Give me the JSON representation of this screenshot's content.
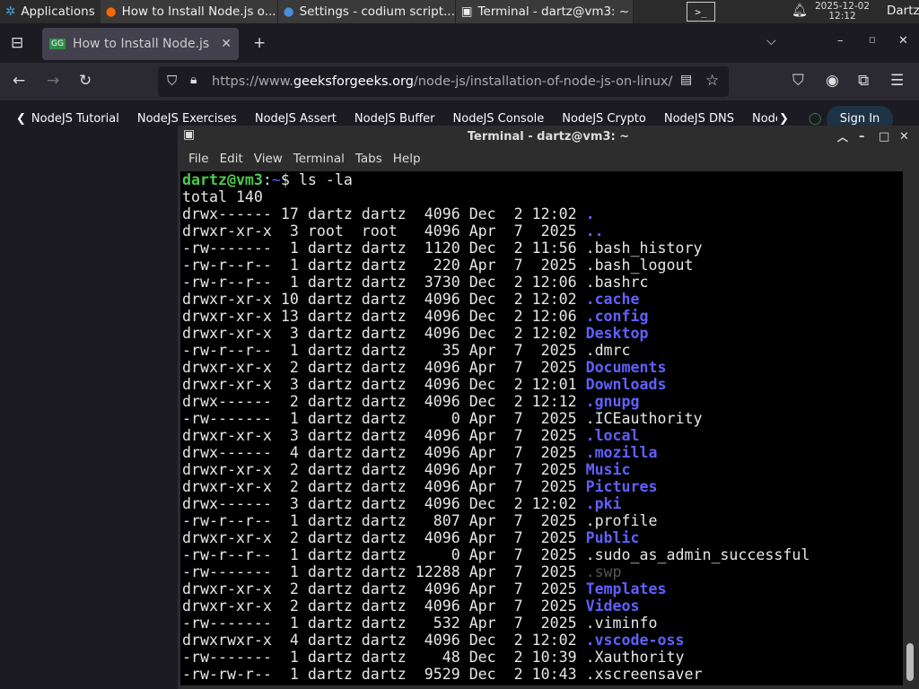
{
  "taskbar": {
    "apps": "Applications",
    "tasks": [
      "How to Install Node.js o...",
      "Settings - codium script...",
      "Terminal - dartz@vm3: ~"
    ],
    "date": "2025-12-02",
    "time": "12:12",
    "user": "Dartz"
  },
  "browser": {
    "tab_title": "How to Install Node.js or",
    "url_prefix": "https://www.",
    "url_domain": "geeksforgeeks.org",
    "url_path": "/node-js/installation-of-node-js-on-linux/",
    "bookmarks": [
      "NodeJS Tutorial",
      "NodeJS Exercises",
      "NodeJS Assert",
      "NodeJS Buffer",
      "NodeJS Console",
      "NodeJS Crypto",
      "NodeJS DNS",
      "Node"
    ],
    "signin": "Sign In"
  },
  "terminal": {
    "title": "Terminal - dartz@vm3: ~",
    "menu": [
      "File",
      "Edit",
      "View",
      "Terminal",
      "Tabs",
      "Help"
    ],
    "prompt_user": "dartz@vm3",
    "prompt_path": "~",
    "command": "$ ls -la",
    "total": "total 140",
    "entries": [
      [
        "drwx------ 17 dartz dartz  4096 Dec  2 12:02 ",
        ".",
        "dir"
      ],
      [
        "drwxr-xr-x  3 root  root   4096 Apr  7  2025 ",
        "..",
        "dir"
      ],
      [
        "-rw-------  1 dartz dartz  1120 Dec  2 11:56 ",
        ".bash_history",
        ""
      ],
      [
        "-rw-r--r--  1 dartz dartz   220 Apr  7  2025 ",
        ".bash_logout",
        ""
      ],
      [
        "-rw-r--r--  1 dartz dartz  3730 Dec  2 12:06 ",
        ".bashrc",
        ""
      ],
      [
        "drwxr-xr-x 10 dartz dartz  4096 Dec  2 12:02 ",
        ".cache",
        "dir"
      ],
      [
        "drwxr-xr-x 13 dartz dartz  4096 Dec  2 12:06 ",
        ".config",
        "dir"
      ],
      [
        "drwxr-xr-x  3 dartz dartz  4096 Dec  2 12:02 ",
        "Desktop",
        "dir"
      ],
      [
        "-rw-r--r--  1 dartz dartz    35 Apr  7  2025 ",
        ".dmrc",
        ""
      ],
      [
        "drwxr-xr-x  2 dartz dartz  4096 Apr  7  2025 ",
        "Documents",
        "dir"
      ],
      [
        "drwxr-xr-x  3 dartz dartz  4096 Dec  2 12:01 ",
        "Downloads",
        "dir"
      ],
      [
        "drwx------  2 dartz dartz  4096 Dec  2 12:12 ",
        ".gnupg",
        "dir"
      ],
      [
        "-rw-------  1 dartz dartz     0 Apr  7  2025 ",
        ".ICEauthority",
        ""
      ],
      [
        "drwxr-xr-x  3 dartz dartz  4096 Apr  7  2025 ",
        ".local",
        "dir"
      ],
      [
        "drwx------  4 dartz dartz  4096 Apr  7  2025 ",
        ".mozilla",
        "dir"
      ],
      [
        "drwxr-xr-x  2 dartz dartz  4096 Apr  7  2025 ",
        "Music",
        "dir"
      ],
      [
        "drwxr-xr-x  2 dartz dartz  4096 Apr  7  2025 ",
        "Pictures",
        "dir"
      ],
      [
        "drwx------  3 dartz dartz  4096 Dec  2 12:02 ",
        ".pki",
        "dir"
      ],
      [
        "-rw-r--r--  1 dartz dartz   807 Apr  7  2025 ",
        ".profile",
        ""
      ],
      [
        "drwxr-xr-x  2 dartz dartz  4096 Apr  7  2025 ",
        "Public",
        "dir"
      ],
      [
        "-rw-r--r--  1 dartz dartz     0 Apr  7  2025 ",
        ".sudo_as_admin_successful",
        ""
      ],
      [
        "-rw-------  1 dartz dartz 12288 Apr  7  2025 ",
        ".swp",
        "dim"
      ],
      [
        "drwxr-xr-x  2 dartz dartz  4096 Apr  7  2025 ",
        "Templates",
        "dir"
      ],
      [
        "drwxr-xr-x  2 dartz dartz  4096 Apr  7  2025 ",
        "Videos",
        "dir"
      ],
      [
        "-rw-------  1 dartz dartz   532 Apr  7  2025 ",
        ".viminfo",
        ""
      ],
      [
        "drwxrwxr-x  4 dartz dartz  4096 Dec  2 12:02 ",
        ".vscode-oss",
        "dir"
      ],
      [
        "-rw-------  1 dartz dartz    48 Dec  2 10:39 ",
        ".Xauthority",
        ""
      ],
      [
        "-rw-rw-r--  1 dartz dartz  9529 Dec  2 10:43 ",
        ".xscreensaver",
        ""
      ]
    ]
  }
}
